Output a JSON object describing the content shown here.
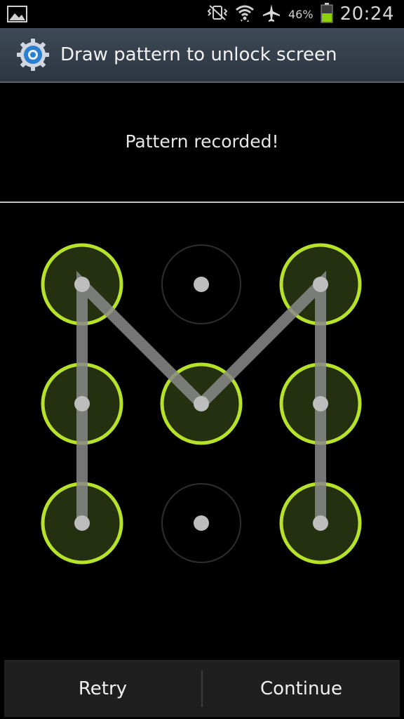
{
  "status_bar": {
    "battery_percent": "46%",
    "time": "20:24",
    "icons": [
      "gallery-notification-icon",
      "vibrate-icon",
      "wifi-icon",
      "airplane-mode-icon",
      "battery-icon"
    ]
  },
  "title_bar": {
    "title": "Draw pattern to unlock screen",
    "icon": "settings-gear-icon"
  },
  "header": {
    "message": "Pattern recorded!"
  },
  "pattern": {
    "grid": [
      [
        true,
        false,
        true
      ],
      [
        true,
        true,
        true
      ],
      [
        true,
        false,
        true
      ]
    ],
    "path": [
      [
        2,
        0
      ],
      [
        1,
        0
      ],
      [
        0,
        0
      ],
      [
        1,
        1
      ],
      [
        0,
        2
      ],
      [
        1,
        2
      ],
      [
        2,
        2
      ]
    ],
    "colors": {
      "active_ring": "#b7e22a",
      "active_fill": "#243010",
      "inactive_ring": "#2e2e2e",
      "dot": "#bdbdbd",
      "line": "#8a8a8a"
    }
  },
  "buttons": {
    "retry": "Retry",
    "continue": "Continue"
  }
}
